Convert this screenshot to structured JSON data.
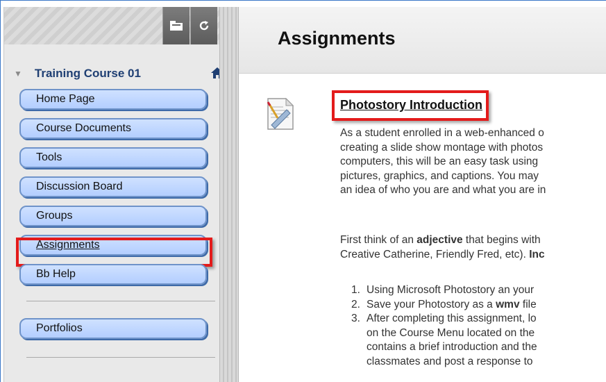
{
  "sidebar": {
    "course_title": "Training Course 01",
    "tools": {
      "folder_icon": "folder-icon",
      "refresh_icon": "refresh-icon"
    },
    "items": [
      {
        "label": "Home Page"
      },
      {
        "label": "Course Documents"
      },
      {
        "label": "Tools"
      },
      {
        "label": "Discussion Board"
      },
      {
        "label": "Groups"
      },
      {
        "label": "Assignments"
      },
      {
        "label": "Bb Help"
      },
      {
        "label": "Portfolios"
      }
    ],
    "active_item": "Assignments"
  },
  "main": {
    "title": "Assignments",
    "item": {
      "title": "Photostory Introduction",
      "para1": [
        "As a student enrolled in a web-enhanced o",
        "creating a slide show montage with photos",
        "computers, this will be an easy task using",
        "pictures, graphics, and captions. You may",
        "an idea of who you are and what you are in"
      ],
      "para2": {
        "l1_pre": "First think of an ",
        "l1_bold": "adjective",
        "l1_post": " that begins with",
        "l2_pre": "Creative Catherine, Friendly Fred, etc). ",
        "l2_bold": "Inc"
      },
      "steps": [
        {
          "num": "1.",
          "text": "Using Microsoft Photostory an your"
        },
        {
          "num": "2.",
          "text_pre": "Save your Photostory as a ",
          "text_bold": "wmv",
          "text_post": " file"
        },
        {
          "num": "3.",
          "text": "After completing this assignment, lo"
        },
        {
          "num": "",
          "text": "on the Course Menu located on the"
        },
        {
          "num": "",
          "text": "contains a brief introduction and the"
        },
        {
          "num": "",
          "text": "classmates and post a response to"
        }
      ]
    }
  },
  "colors": {
    "highlight": "#e31b1b",
    "menu_fill": "#b3ceff",
    "course_title": "#1f3f73"
  }
}
